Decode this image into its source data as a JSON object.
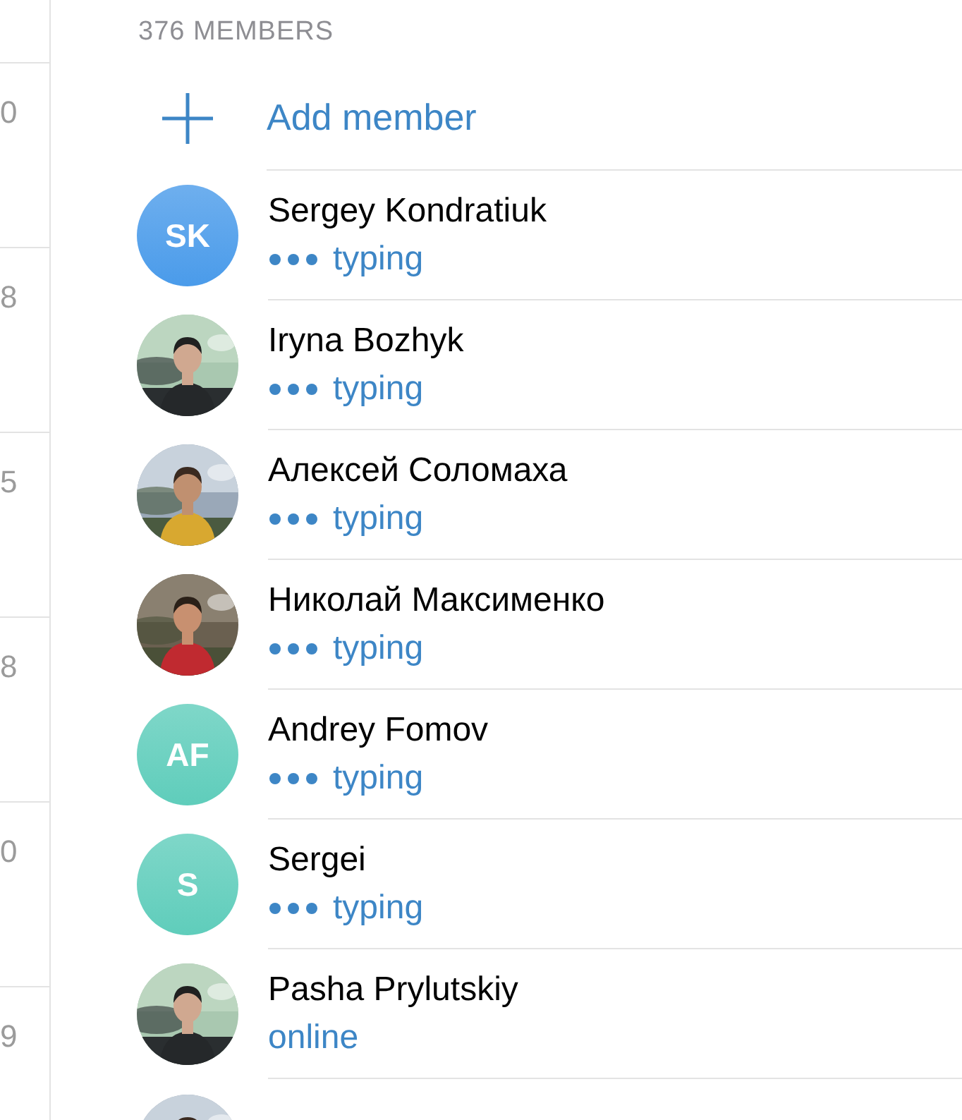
{
  "side_column": [
    "0",
    "8",
    "5",
    "8",
    "0",
    "9"
  ],
  "members_header": "376 MEMBERS",
  "add_member": {
    "label": "Add member"
  },
  "members": [
    {
      "avatar": {
        "kind": "initials",
        "initials": "SK",
        "color": "#4a9bea"
      },
      "name": "Sergey Kondratiuk",
      "status": {
        "kind": "typing",
        "text": "typing"
      }
    },
    {
      "avatar": {
        "kind": "picture"
      },
      "name": "Iryna Bozhyk",
      "status": {
        "kind": "typing",
        "text": "typing"
      }
    },
    {
      "avatar": {
        "kind": "picture"
      },
      "name": "Алексей Соломаха",
      "status": {
        "kind": "typing",
        "text": "typing"
      }
    },
    {
      "avatar": {
        "kind": "picture"
      },
      "name": "Николай Максименко",
      "status": {
        "kind": "typing",
        "text": "typing"
      }
    },
    {
      "avatar": {
        "kind": "initials",
        "initials": "AF",
        "color": "#5fcdbb"
      },
      "name": "Andrey Fomov",
      "status": {
        "kind": "typing",
        "text": "typing"
      }
    },
    {
      "avatar": {
        "kind": "initials",
        "initials": "S",
        "color": "#5fcdbb"
      },
      "name": "Sergei",
      "status": {
        "kind": "typing",
        "text": "typing"
      }
    },
    {
      "avatar": {
        "kind": "picture"
      },
      "name": "Pasha Prylutskiy",
      "status": {
        "kind": "online",
        "text": "online"
      }
    },
    {
      "avatar": {
        "kind": "picture"
      }
    }
  ]
}
